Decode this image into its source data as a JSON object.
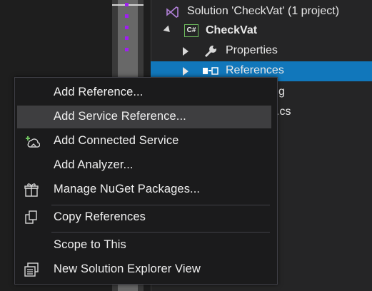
{
  "solution_explorer": {
    "solution_label": "Solution 'CheckVat' (1 project)",
    "project_badge": "C#",
    "project_label": "CheckVat",
    "properties_label": "Properties",
    "references_label": "References",
    "partial_item_1": "fig",
    "partial_item_2": ".cs",
    "selected_item": "References"
  },
  "context_menu": {
    "items": [
      {
        "label": "Add Reference...",
        "icon": "none"
      },
      {
        "label": "Add Service Reference...",
        "icon": "none",
        "hovered": true
      },
      {
        "label": "Add Connected Service",
        "icon": "connected-service-icon"
      },
      {
        "label": "Add Analyzer...",
        "icon": "none"
      },
      {
        "label": "Manage NuGet Packages...",
        "icon": "nuget-package-icon"
      },
      {
        "label": "Copy References",
        "icon": "copy-icon"
      },
      {
        "label": "Scope to This",
        "icon": "none"
      },
      {
        "label": "New Solution Explorer View",
        "icon": "new-explorer-view-icon"
      }
    ]
  },
  "colors": {
    "selection": "#1177bb",
    "menu_hover": "#3e3e40",
    "solution_icon": "#b180d7",
    "project_icon_green": "#6fbf5f",
    "marker": "#a020f0"
  }
}
